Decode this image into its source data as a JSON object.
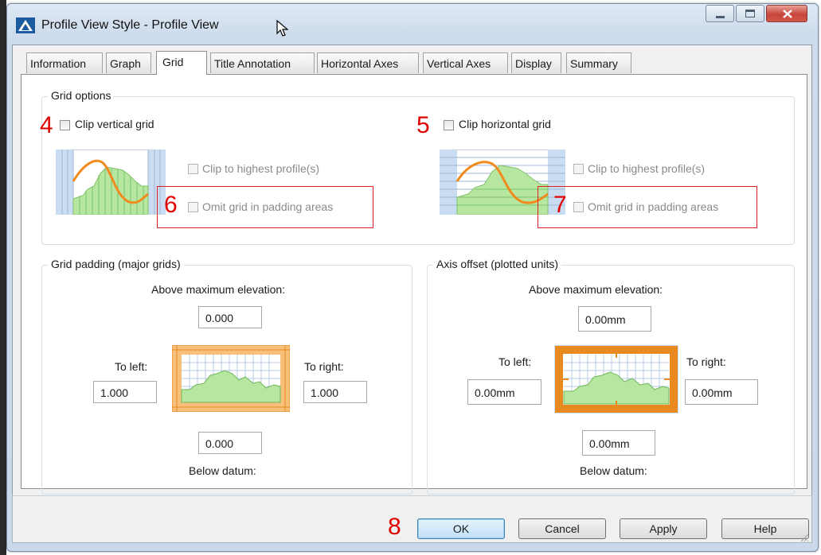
{
  "window": {
    "title": "Profile View Style - Profile View"
  },
  "tabs": [
    {
      "label": "Information"
    },
    {
      "label": "Graph"
    },
    {
      "label": "Grid"
    },
    {
      "label": "Title Annotation"
    },
    {
      "label": "Horizontal Axes"
    },
    {
      "label": "Vertical Axes"
    },
    {
      "label": "Display"
    },
    {
      "label": "Summary"
    }
  ],
  "active_tab": "Grid",
  "grid_options": {
    "label": "Grid options",
    "clip_vertical": {
      "label": "Clip vertical grid",
      "checked": false,
      "clip_highest": "Clip to highest profile(s)",
      "omit_padding": "Omit grid in padding areas"
    },
    "clip_horizontal": {
      "label": "Clip horizontal grid",
      "checked": false,
      "clip_highest": "Clip to highest profile(s)",
      "omit_padding": "Omit grid in padding areas"
    }
  },
  "grid_padding": {
    "label": "Grid padding (major grids)",
    "above_label": "Above maximum elevation:",
    "above_value": "0.000",
    "left_label": "To left:",
    "left_value": "1.000",
    "right_label": "To right:",
    "right_value": "1.000",
    "below_value": "0.000",
    "below_label": "Below datum:"
  },
  "axis_offset": {
    "label": "Axis offset (plotted units)",
    "above_label": "Above maximum elevation:",
    "above_value": "0.00mm",
    "left_label": "To left:",
    "left_value": "0.00mm",
    "right_label": "To right:",
    "right_value": "0.00mm",
    "below_value": "0.00mm",
    "below_label": "Below datum:"
  },
  "annotations": {
    "n4": "4",
    "n5": "5",
    "n6": "6",
    "n7": "7",
    "n8": "8"
  },
  "buttons": {
    "ok": "OK",
    "cancel": "Cancel",
    "apply": "Apply",
    "help": "Help"
  },
  "colors": {
    "annotation_red": "#e02020",
    "profile_orange": "#f08a1c",
    "profile_green": "#b6e6a0",
    "padding_blue": "#c9dcf2"
  }
}
